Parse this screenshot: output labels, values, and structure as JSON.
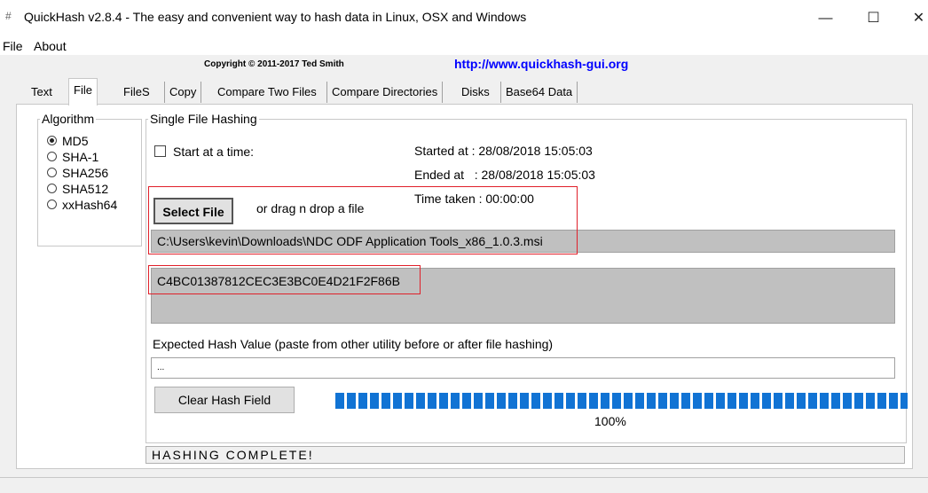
{
  "window": {
    "title": "QuickHash v2.8.4 - The easy and convenient way to hash data in Linux, OSX and Windows",
    "app_icon": "#",
    "minimize": "—",
    "maximize": "☐",
    "close": "✕"
  },
  "menu": {
    "file": "File",
    "about": "About"
  },
  "header": {
    "copyright": "Copyright © 2011-2017 Ted Smith",
    "url": "http://www.quickhash-gui.org"
  },
  "tabs": [
    "Text",
    "File",
    "FileS",
    "Copy",
    "Compare Two Files",
    "Compare Directories",
    "Disks",
    "Base64 Data"
  ],
  "active_tab": "File",
  "algorithm": {
    "legend": "Algorithm",
    "options": [
      "MD5",
      "SHA-1",
      "SHA256",
      "SHA512",
      "xxHash64"
    ],
    "selected": "MD5"
  },
  "single": {
    "legend": "Single File Hashing",
    "start_at_label": "Start at a time:",
    "started_at": "Started at : 28/08/2018 15:05:03",
    "ended_at": "Ended at   : 28/08/2018 15:05:03",
    "time_taken": "Time taken : 00:00:00",
    "select_file": "Select File",
    "drag_drop": "or drag n drop a file",
    "file_path": "C:\\Users\\kevin\\Downloads\\NDC ODF Application Tools_x86_1.0.3.msi",
    "hash_result": "C4BC01387812CEC3E3BC0E4D21F2F86B",
    "expected_label": "Expected Hash Value (paste from other utility before or after file hashing)",
    "expected_value": "...",
    "clear_button": "Clear Hash Field",
    "progress_percent": "100%",
    "progress_fraction": 1.0,
    "status": "HASHING COMPLETE!"
  },
  "colors": {
    "progress": "#1173d4",
    "highlight": "#e0202a",
    "link": "#0000ff"
  }
}
